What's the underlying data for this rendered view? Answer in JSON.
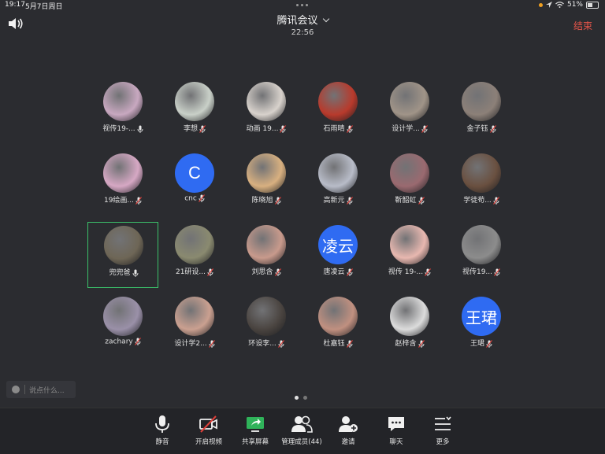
{
  "status_bar": {
    "time": "19:17",
    "date": "5月7日周日",
    "battery": "51%"
  },
  "meeting": {
    "title": "腾讯会议",
    "timer": "22:56",
    "end_label": "结束"
  },
  "participants": [
    {
      "name": "视传19-...",
      "avatar": "photo",
      "color": "#c8a8c0",
      "mic": "on"
    },
    {
      "name": "李想",
      "avatar": "photo",
      "color": "#c9d0c8",
      "mic": "off"
    },
    {
      "name": "动画 19...",
      "avatar": "photo",
      "color": "#d8d2cc",
      "mic": "off"
    },
    {
      "name": "石雨晴",
      "avatar": "photo",
      "color": "#b83a2c",
      "mic": "off"
    },
    {
      "name": "设计学...",
      "avatar": "photo",
      "color": "#a09488",
      "mic": "off"
    },
    {
      "name": "金子钰",
      "avatar": "photo",
      "color": "#8c8078",
      "mic": "off"
    },
    {
      "name": "19绘画...",
      "avatar": "photo",
      "color": "#d6a8c4",
      "mic": "off"
    },
    {
      "name": "cnc",
      "avatar": "letter",
      "text": "C",
      "color": "#2f6bf2",
      "mic": "off"
    },
    {
      "name": "陈晓旭",
      "avatar": "photo",
      "color": "#d8b080",
      "mic": "off"
    },
    {
      "name": "高新元",
      "avatar": "photo",
      "color": "#b8bcc8",
      "mic": "off"
    },
    {
      "name": "靳韶虹",
      "avatar": "photo",
      "color": "#9a6a70",
      "mic": "off"
    },
    {
      "name": "学徒苟...",
      "avatar": "photo",
      "color": "#6a5040",
      "mic": "off"
    },
    {
      "name": "兜兜爸",
      "avatar": "photo",
      "color": "#6e6656",
      "mic": "on",
      "active": true
    },
    {
      "name": "21研设...",
      "avatar": "photo",
      "color": "#8a8a70",
      "mic": "off"
    },
    {
      "name": "刘思含",
      "avatar": "photo",
      "color": "#c89a8c",
      "mic": "off"
    },
    {
      "name": "唐凌云",
      "avatar": "text",
      "text": "凌云",
      "color": "#2f6bf2",
      "mic": "off"
    },
    {
      "name": "视传 19-...",
      "avatar": "photo",
      "color": "#e8b8b0",
      "mic": "off"
    },
    {
      "name": "视传19...",
      "avatar": "photo",
      "color": "#8c8c8c",
      "mic": "off"
    },
    {
      "name": "zachary",
      "avatar": "photo",
      "color": "#9a90a8",
      "mic": "off"
    },
    {
      "name": "设计学2...",
      "avatar": "photo",
      "color": "#caa090",
      "mic": "off"
    },
    {
      "name": "环设李...",
      "avatar": "photo",
      "color": "#4a4440",
      "mic": "off"
    },
    {
      "name": "杜嘉钰",
      "avatar": "photo",
      "color": "#c09080",
      "mic": "off"
    },
    {
      "name": "赵梓含",
      "avatar": "photo",
      "color": "#dcdcdc",
      "mic": "off"
    },
    {
      "name": "王珺",
      "avatar": "text",
      "text": "王珺",
      "color": "#2f6bf2",
      "mic": "off"
    }
  ],
  "chat": {
    "placeholder": "说点什么..."
  },
  "toolbar": {
    "mute": "静音",
    "video": "开启视频",
    "share": "共享屏幕",
    "members": "管理成员(44)",
    "invite": "邀请",
    "chat": "聊天",
    "more": "更多"
  },
  "colors": {
    "background": "#2b2c30",
    "end_red": "#e8554a",
    "active_green": "#3bc16a",
    "avatar_blue": "#2f6bf2",
    "muted_red": "#e0403a",
    "share_green": "#2fb35a"
  }
}
